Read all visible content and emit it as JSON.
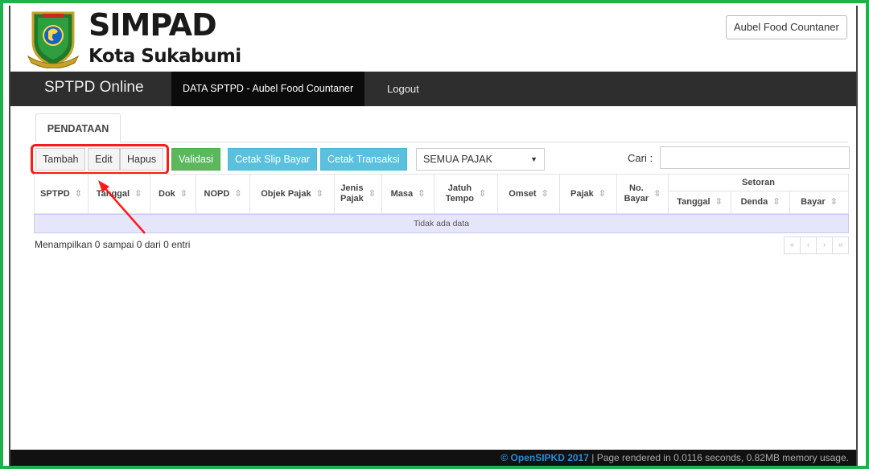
{
  "app": {
    "title": "SIMPAD",
    "subtitle": "Kota Sukabumi",
    "user_button": "Aubel Food Countaner"
  },
  "nav": {
    "brand": "SPTPD Online",
    "active_item": "DATA SPTPD - Aubel Food Countaner",
    "logout": "Logout"
  },
  "tabs": [
    {
      "label": "PENDATAAN"
    }
  ],
  "toolbar": {
    "tambah": "Tambah",
    "edit": "Edit",
    "hapus": "Hapus",
    "validasi": "Validasi",
    "cetak_slip": "Cetak Slip Bayar",
    "cetak_transaksi": "Cetak Transaksi",
    "filter_value": "SEMUA PAJAK",
    "search_label": "Cari :",
    "search_value": ""
  },
  "table": {
    "columns": [
      "SPTPD",
      "Tanggal",
      "Dok",
      "NOPD",
      "Objek Pajak",
      "Jenis",
      "Pajak",
      "Masa",
      "Jatuh",
      "Tempo",
      "Omset",
      "Pajak",
      "No.",
      "Bayar"
    ],
    "group_header": "Setoran",
    "sub_columns": [
      "Tanggal",
      "Denda",
      "Bayar"
    ],
    "empty_message": "Tidak ada data"
  },
  "pagination": {
    "info": "Menampilkan 0 sampai 0 dari 0 entri",
    "first": "«",
    "prev": "‹",
    "next": "›",
    "last": "»"
  },
  "footer": {
    "brand": "© OpenSIPKD 2017",
    "text": " | Page rendered in 0.0116 seconds, 0.82MB memory usage."
  },
  "colors": {
    "frame": "#21b04b",
    "navbar": "#2e2e2e",
    "validasi": "#5cb85c",
    "cetak": "#5bc0de",
    "highlight": "#ff1a1a",
    "empty_row": "#e6e6fa"
  }
}
